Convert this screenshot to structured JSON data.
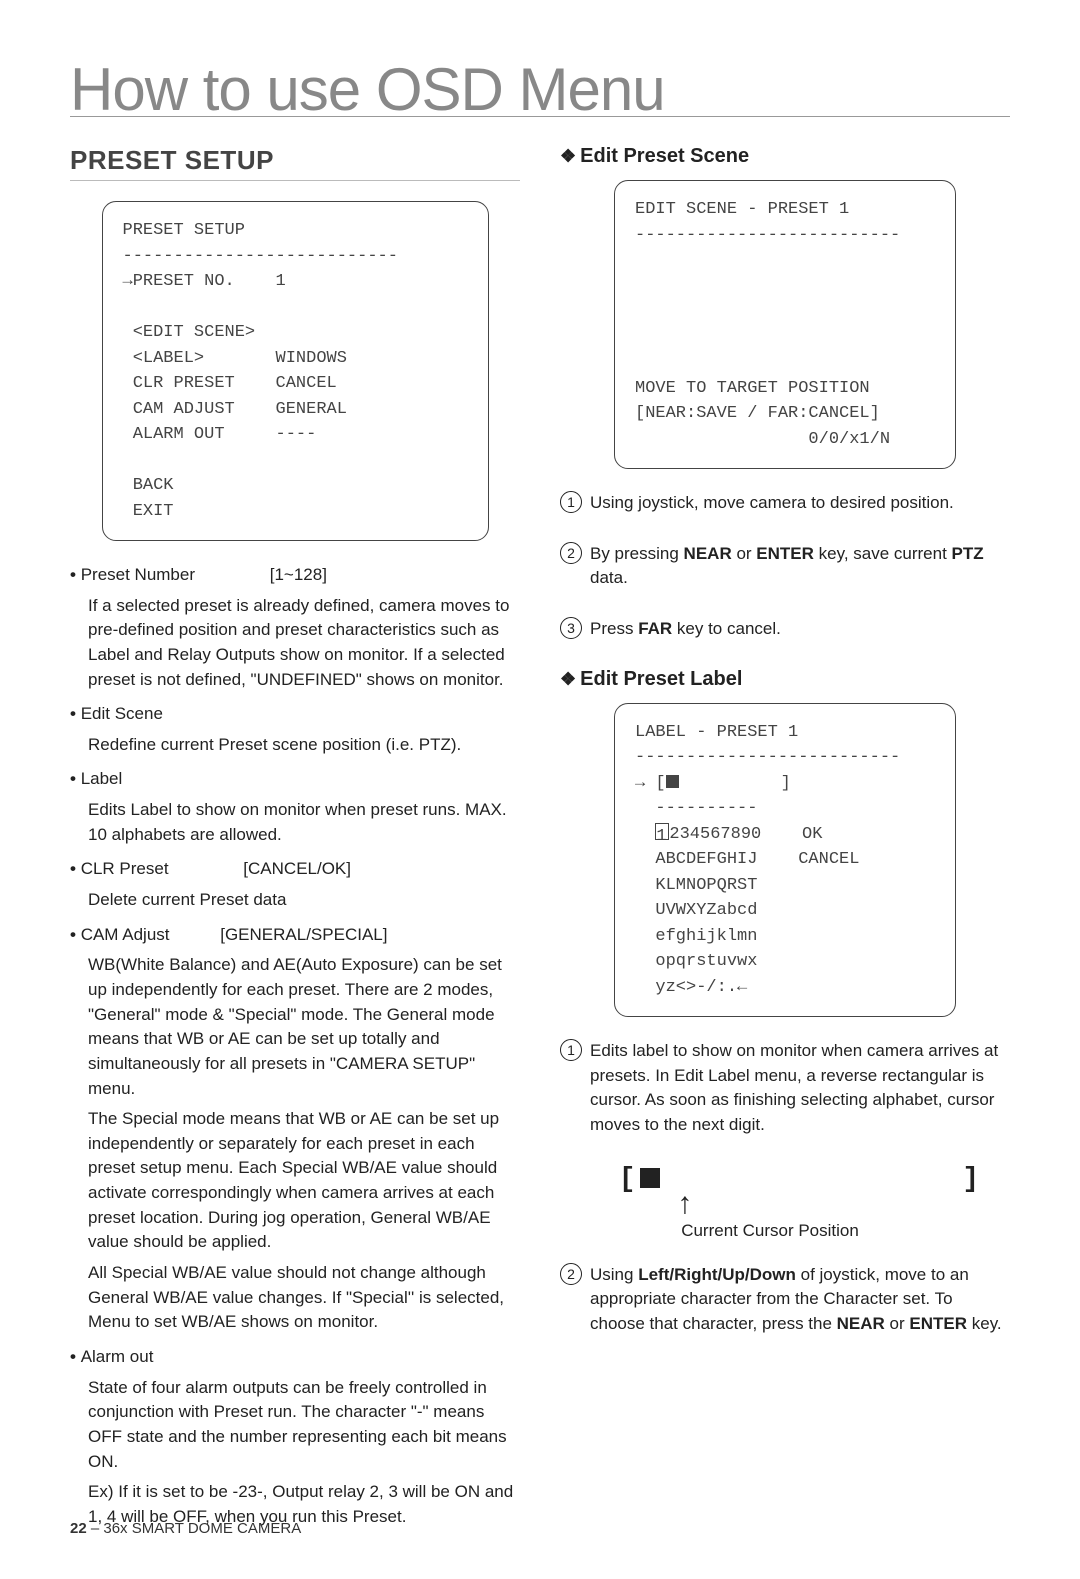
{
  "page_title": "How to use OSD Menu",
  "left": {
    "heading": "PRESET SETUP",
    "screen": "PRESET SETUP\n---------------------------\n→PRESET NO.    1\n\n <EDIT SCENE>\n <LABEL>       WINDOWS\n CLR PRESET    CANCEL\n CAM ADJUST    GENERAL\n ALARM OUT     ----\n\n BACK\n EXIT",
    "bullets": [
      {
        "label": "Preset Number",
        "value": "[1~128]",
        "descs": [
          "If a selected preset is already defined, camera moves to pre-defined position and preset characteristics such as Label and Relay Outputs show on monitor. If a selected preset is not defined, \"UNDEFINED\" shows on monitor."
        ]
      },
      {
        "label": "Edit Scene",
        "descs": [
          "Redefine current Preset scene position (i.e. PTZ)."
        ]
      },
      {
        "label": "Label",
        "descs": [
          "Edits Label to show on monitor when preset runs. MAX. 10 alphabets are allowed."
        ]
      },
      {
        "label": "CLR Preset",
        "value": "[CANCEL/OK]",
        "descs": [
          "Delete current Preset data"
        ]
      },
      {
        "label": "CAM Adjust",
        "value": "[GENERAL/SPECIAL]",
        "descs": [
          "WB(White Balance) and AE(Auto Exposure) can be set up independently for each preset. There are 2 modes, \"General\" mode & \"Special\" mode. The General mode means that WB or AE can be set up totally and simultaneously for all presets in \"CAMERA SETUP\" menu.",
          "The Special mode means that WB or AE can be set up independently or separately for each preset in each preset setup menu. Each Special WB/AE value should activate correspondingly when camera arrives at each preset location. During jog operation, General WB/AE value should be applied.",
          "All Special WB/AE value should not change although General WB/AE value changes. If \"Special'' is selected, Menu to set WB/AE shows on monitor."
        ]
      },
      {
        "label": "Alarm out",
        "descs": [
          "State of four alarm outputs can be freely controlled in conjunction with Preset run. The character \"-\" means OFF state and the number representing each bit means ON.",
          "Ex) If it is set to be -23-, Output relay 2, 3 will be ON and 1, 4 will be OFF, when you run this Preset."
        ]
      }
    ]
  },
  "right": {
    "edit_scene": {
      "heading": "Edit Preset Scene",
      "screen": "EDIT SCENE - PRESET 1\n--------------------------\n\n\n\n\n\nMOVE TO TARGET POSITION\n[NEAR:SAVE / FAR:CANCEL]\n                 0/0/x1/N",
      "steps": [
        {
          "text_before": "Using joystick, move camera to desired position."
        },
        {
          "text_before": "By pressing ",
          "strong1": "NEAR",
          "mid1": " or ",
          "strong2": "ENTER",
          "mid2": " key, save current ",
          "strong3": "PTZ",
          "after": " data."
        },
        {
          "text_before": "Press ",
          "strong1": "FAR",
          "after": " key to cancel."
        }
      ]
    },
    "edit_label": {
      "heading": "Edit Preset Label",
      "screen_pre": "LABEL - PRESET 1\n--------------------------\n→ [",
      "screen_post": "          ]\n  ----------\n  ",
      "screen_rest": "234567890    OK\n  ABCDEFGHIJ    CANCEL\n  KLMNOPQRST\n  UVWXYZabcd\n  efghijklmn\n  opqrstuvwx\n  yz<>-/:.←\n",
      "steps": [
        {
          "text_before": "Edits label to show on monitor when camera arrives at presets. In Edit Label menu, a reverse rectangular is cursor. As soon as finishing selecting alphabet, cursor moves to the next digit."
        },
        {
          "text_before": "Using ",
          "strong1": "Left/Right/Up/Down",
          "mid1": " of joystick, move to an appropriate character from the Character set. To choose that character, press the ",
          "strong2": "NEAR",
          "mid2": " or ",
          "strong3": "ENTER",
          "after": " key."
        }
      ],
      "cursor_caption": "Current Cursor Position"
    }
  },
  "footer": {
    "page": "22",
    "sep": " – ",
    "title": "36x SMART DOME CAMERA"
  }
}
